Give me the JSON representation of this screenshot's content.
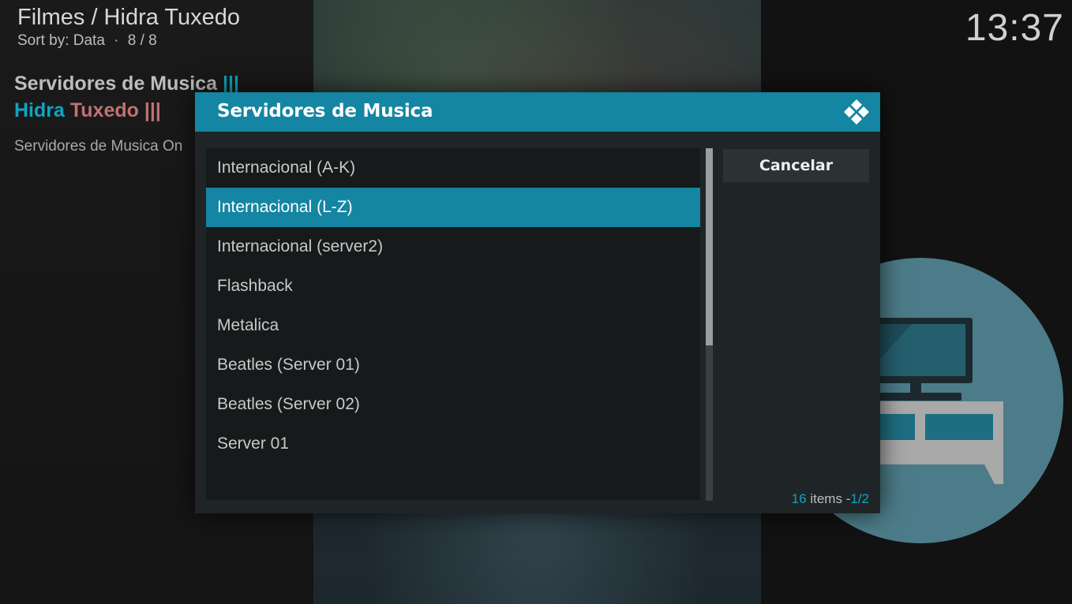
{
  "header": {
    "breadcrumb": "Filmes / Hidra Tuxedo",
    "sort_label": "Sort by: Data",
    "separator": "·",
    "position": "8 / 8",
    "clock": "13:37"
  },
  "left_info": {
    "title_1_main": "Servidores de Musica",
    "title_1_bars": "|||",
    "title_2_part_a": "Hidra",
    "title_2_part_b": "Tuxedo",
    "title_2_bars": "|||",
    "description": "Servidores de Musica On"
  },
  "dialog": {
    "title": "Servidores de Musica",
    "logo_icon": "kodi-logo-icon",
    "items": [
      {
        "label": "Internacional (A-K)",
        "selected": false
      },
      {
        "label": "Internacional (L-Z)",
        "selected": true
      },
      {
        "label": "Internacional (server2)",
        "selected": false
      },
      {
        "label": "Flashback",
        "selected": false
      },
      {
        "label": "Metalica",
        "selected": false
      },
      {
        "label": "Beatles (Server 01)",
        "selected": false
      },
      {
        "label": "Beatles (Server 02)",
        "selected": false
      },
      {
        "label": "Server 01",
        "selected": false
      }
    ],
    "cancel_label": "Cancelar",
    "count": {
      "total": "16",
      "items_word": "items",
      "dash": "-",
      "page": "1/2"
    },
    "scroll_fraction": 0.56
  },
  "colors": {
    "accent": "#1485a2",
    "highlight_text": "#12a4bf",
    "rose_text": "#c07272",
    "dialog_bg": "#1f2527",
    "list_bg": "#161a1b",
    "illustration_circle": "#4c7c89"
  },
  "background": {
    "illustration_icon": "tv-stand-icon"
  }
}
